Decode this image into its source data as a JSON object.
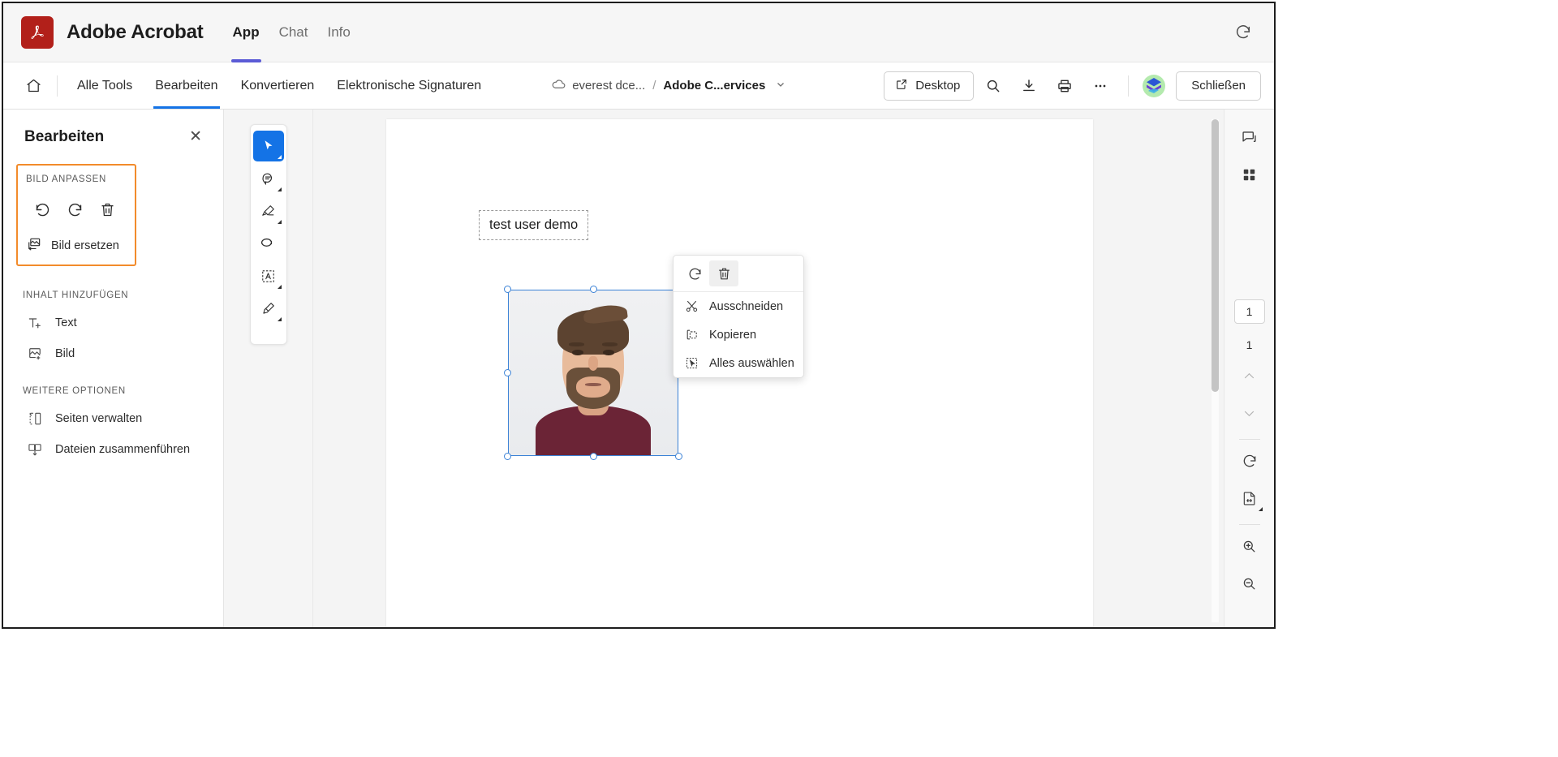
{
  "window": {
    "app_name": "Adobe Acrobat",
    "logo_icon": "adobe-acrobat-logo",
    "refresh_icon": "refresh-icon",
    "tabs": [
      {
        "label": "App",
        "active": true
      },
      {
        "label": "Chat",
        "active": false
      },
      {
        "label": "Info",
        "active": false
      }
    ]
  },
  "toolbar": {
    "home_icon": "home-icon",
    "items": [
      {
        "label": "Alle Tools",
        "active": false
      },
      {
        "label": "Bearbeiten",
        "active": true
      },
      {
        "label": "Konvertieren",
        "active": false
      },
      {
        "label": "Elektronische Signaturen",
        "active": false
      }
    ],
    "breadcrumb": {
      "cloud_icon": "cloud-icon",
      "root": "everest dce...",
      "separator": "/",
      "current": "Adobe C...ervices",
      "caret_icon": "chevron-down-icon"
    },
    "desktop_button": {
      "label": "Desktop",
      "icon": "external-link-icon"
    },
    "search_icon": "search-icon",
    "download_icon": "download-icon",
    "print_icon": "print-icon",
    "more_icon": "ellipsis-icon",
    "avatar_icon": "user-avatar",
    "close_label": "Schließen"
  },
  "left_panel": {
    "title": "Bearbeiten",
    "close_icon": "close-icon",
    "adjust_section": {
      "label": "BILD ANPASSEN",
      "highlighted": true,
      "highlight_color": "#f28b2b",
      "actions": [
        {
          "name": "rotate-left-icon",
          "title": "Nach links drehen"
        },
        {
          "name": "rotate-right-icon",
          "title": "Nach rechts drehen"
        },
        {
          "name": "delete-icon",
          "title": "Löschen"
        }
      ],
      "replace": {
        "label": "Bild ersetzen",
        "icon": "replace-image-icon"
      }
    },
    "add_section": {
      "label": "INHALT HINZUFÜGEN",
      "items": [
        {
          "label": "Text",
          "icon": "add-text-icon"
        },
        {
          "label": "Bild",
          "icon": "add-image-icon"
        }
      ]
    },
    "more_section": {
      "label": "WEITERE OPTIONEN",
      "items": [
        {
          "label": "Seiten verwalten",
          "icon": "manage-pages-icon"
        },
        {
          "label": "Dateien zusammenführen",
          "icon": "merge-files-icon"
        }
      ]
    }
  },
  "tool_strip": {
    "tools": [
      {
        "icon": "select-cursor-icon",
        "selected": true,
        "has_caret": true
      },
      {
        "icon": "comment-icon",
        "selected": false,
        "has_caret": true
      },
      {
        "icon": "highlighter-icon",
        "selected": false,
        "has_caret": true
      },
      {
        "icon": "draw-lasso-icon",
        "selected": false,
        "has_caret": false
      },
      {
        "icon": "text-box-icon",
        "selected": false,
        "has_caret": true
      },
      {
        "icon": "signature-pen-icon",
        "selected": false,
        "has_caret": true
      }
    ]
  },
  "document": {
    "text_object": "test user demo",
    "image_object": {
      "alt": "portrait-photo",
      "selected": true,
      "handles": 8
    }
  },
  "context_menu": {
    "top_actions": [
      {
        "icon": "rotate-right-icon",
        "hover": false
      },
      {
        "icon": "delete-icon",
        "hover": true
      }
    ],
    "items": [
      {
        "label": "Ausschneiden",
        "icon": "cut-scissors-icon"
      },
      {
        "label": "Kopieren",
        "icon": "copy-icon"
      },
      {
        "label": "Alles auswählen",
        "icon": "select-all-icon"
      }
    ]
  },
  "right_rail": {
    "top_buttons": [
      {
        "icon": "comments-panel-icon"
      },
      {
        "icon": "thumbnails-grid-icon"
      }
    ],
    "page_current": "1",
    "page_total": "1",
    "prev_icon": "chevron-up-icon",
    "next_icon": "chevron-down-icon",
    "rotate_icon": "rotate-view-icon",
    "fit_page_icon": "fit-page-icon",
    "zoom_in_icon": "zoom-in-icon",
    "zoom_out_icon": "zoom-out-icon"
  },
  "colors": {
    "brand_red": "#b2201a",
    "accent_blue": "#1473e6",
    "tab_underline": "#5b5bd6",
    "highlight_orange": "#f28b2b",
    "selection_blue": "#3b82d6"
  }
}
